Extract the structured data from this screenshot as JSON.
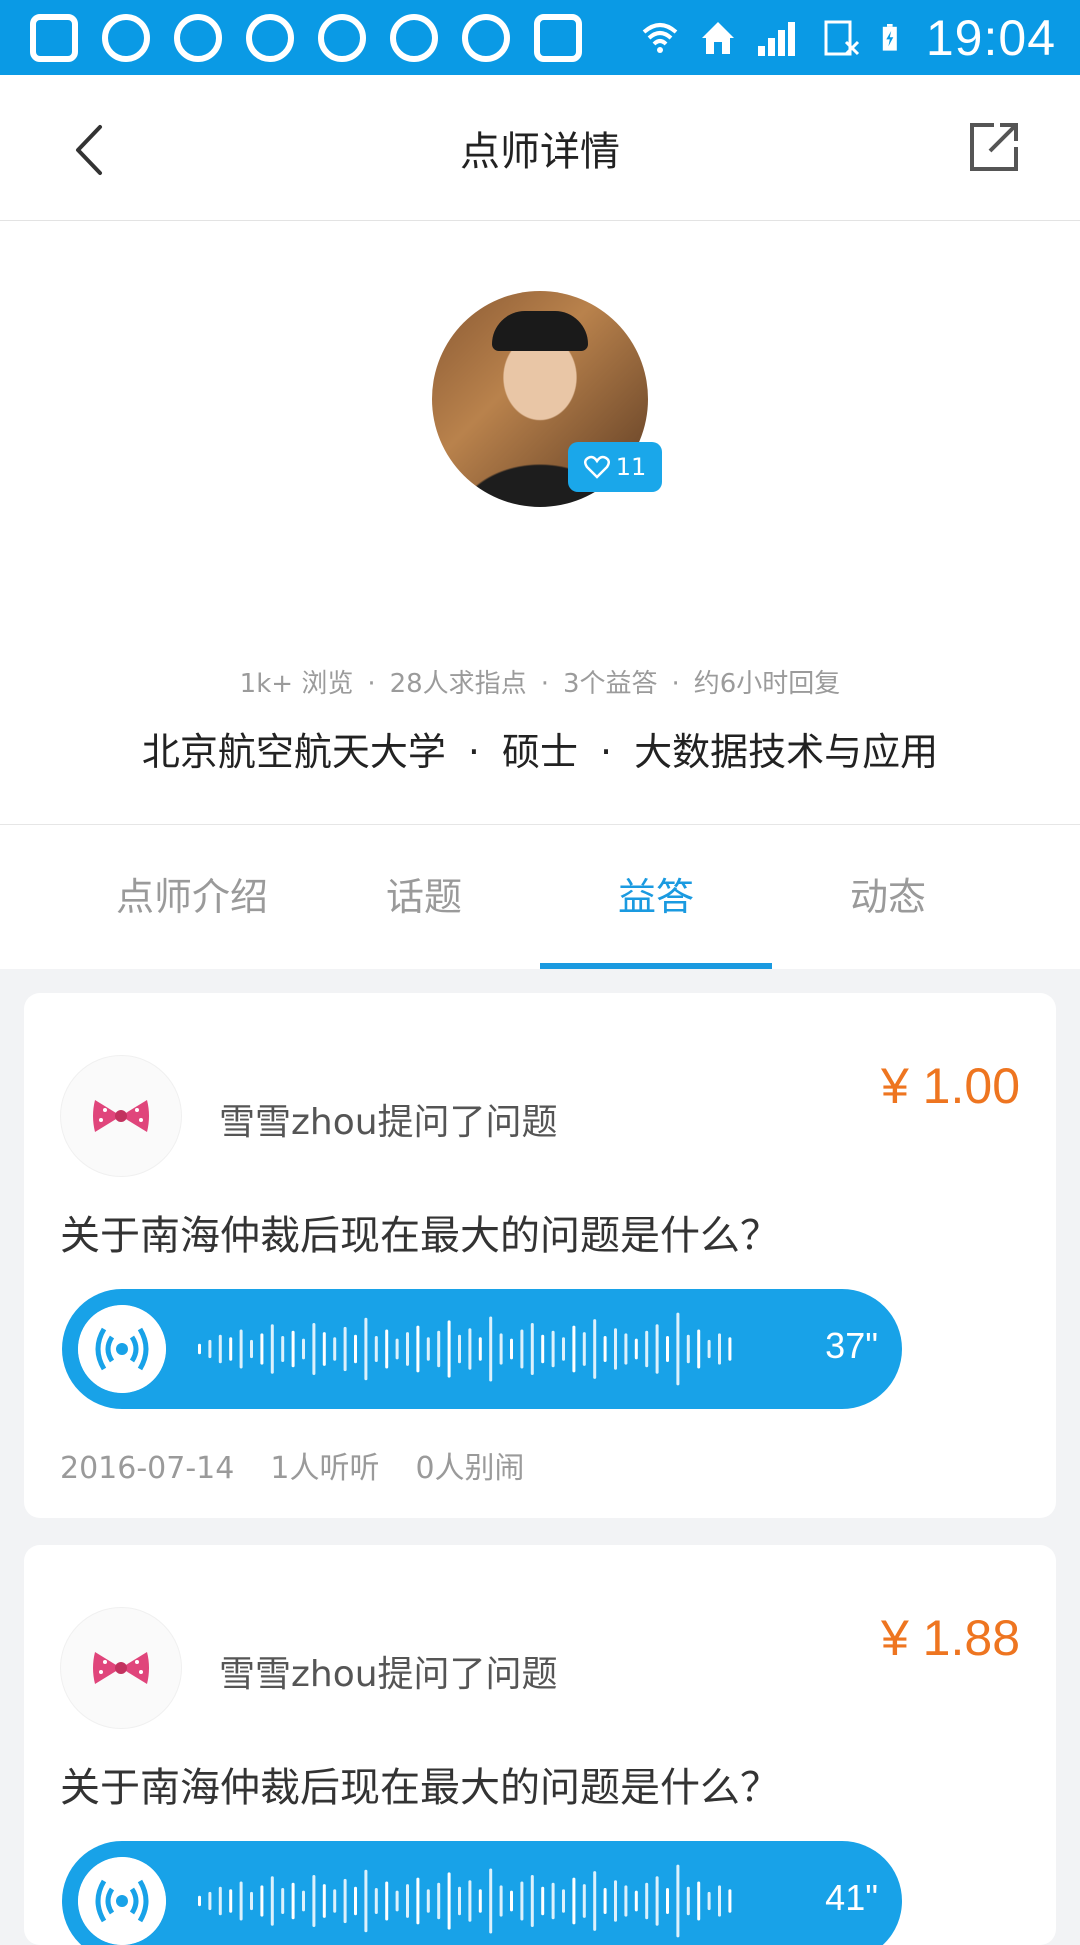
{
  "status_bar": {
    "time": "19:04",
    "notification_icons": [
      "chat-bubble-icon",
      "qq-icon",
      "uc-browser-icon",
      "qq-icon",
      "qq-icon",
      "uc-browser-icon",
      "qq-icon",
      "nfc-icon"
    ],
    "system_icons": [
      "wifi-icon",
      "home-icon",
      "signal-icon",
      "sim-icon",
      "battery-charging-icon"
    ]
  },
  "nav": {
    "title": "点师详情",
    "back_icon": "chevron-left-icon",
    "share_icon": "external-share-icon"
  },
  "profile": {
    "like_count": "11",
    "stats": [
      "1k+ 浏览",
      "28人求指点",
      "3个益答",
      "约6小时回复"
    ],
    "education": [
      "北京航空航天大学",
      "硕士",
      "大数据技术与应用"
    ],
    "separator": "·"
  },
  "tabs": {
    "items": [
      {
        "label": "点师介绍"
      },
      {
        "label": "话题"
      },
      {
        "label": "益答"
      },
      {
        "label": "动态"
      }
    ],
    "active_index": 2
  },
  "answers": [
    {
      "asker": "雪雪zhou提问了问题",
      "price": "¥ 1.00",
      "question": "关于南海仲裁后现在最大的问题是什么？",
      "duration": "37\"",
      "date": "2016-07-14",
      "listens": "1人听听",
      "complaints": "0人别闹"
    },
    {
      "asker": "雪雪zhou提问了问题",
      "price": "¥ 1.88",
      "question": "关于南海仲裁后现在最大的问题是什么？",
      "duration": "41\""
    }
  ],
  "colors": {
    "status_bar": "#0a9ae5",
    "accent": "#1a9ae0",
    "price": "#ee7520",
    "voice_bubble": "#18a2e8"
  }
}
